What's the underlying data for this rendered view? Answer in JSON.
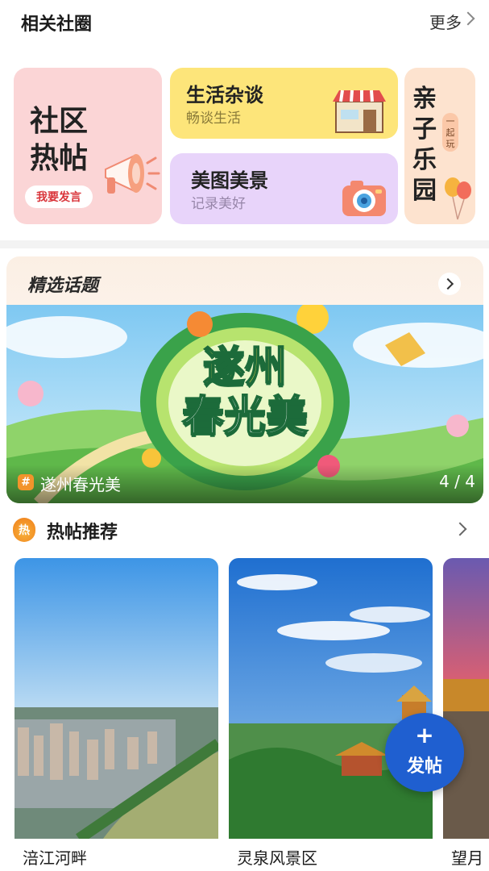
{
  "related_circles": {
    "title": "相关社圈",
    "more": "更多",
    "cards": {
      "community": {
        "title_line1": "社区",
        "title_line2": "热帖",
        "action": "我要发言"
      },
      "life": {
        "title": "生活杂谈",
        "subtitle": "畅谈生活"
      },
      "photo": {
        "title": "美图美景",
        "subtitle": "记录美好"
      },
      "parent": {
        "title": "亲子乐园",
        "tag": "一起玩"
      }
    }
  },
  "featured_topics": {
    "title": "精选话题",
    "banner": {
      "art_text_line1": "遂州",
      "art_text_line2": "春光美",
      "name": "遂州春光美",
      "index": "4 / 4"
    }
  },
  "hot_posts": {
    "icon_text": "热",
    "title": "热帖推荐",
    "items": [
      {
        "caption": "涪江河畔"
      },
      {
        "caption": "灵泉风景区"
      },
      {
        "caption": "望月"
      }
    ]
  },
  "fab": {
    "plus": "+",
    "label": "发帖"
  }
}
